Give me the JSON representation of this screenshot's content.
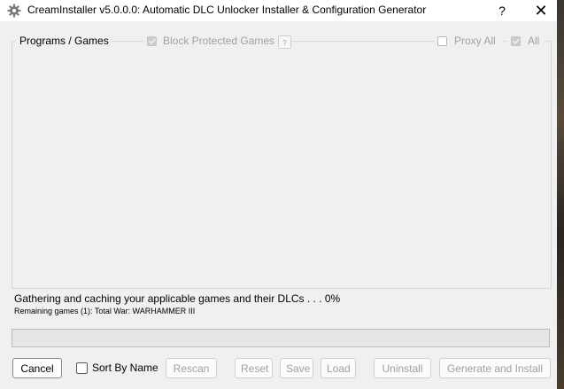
{
  "window": {
    "title": "CreamInstaller v5.0.0.0: Automatic DLC Unlocker Installer & Configuration Generator",
    "help_label": "?",
    "close_label": "✕"
  },
  "group": {
    "title": "Programs / Games",
    "block_protected_label": "Block Protected Games",
    "block_protected_checked": true,
    "help_label": "?",
    "proxy_all_label": "Proxy All",
    "proxy_all_checked": false,
    "all_label": "All",
    "all_checked": true
  },
  "status": {
    "main": "Gathering and caching your applicable games and their DLCs . . . 0%",
    "sub": "Remaining games (1): Total War: WARHAMMER III",
    "progress_percent": 0
  },
  "buttons": {
    "cancel": "Cancel",
    "sort_by_name": "Sort By Name",
    "sort_by_name_checked": false,
    "rescan": "Rescan",
    "reset": "Reset",
    "save": "Save",
    "load": "Load",
    "uninstall": "Uninstall",
    "generate_install": "Generate and Install"
  },
  "colors": {
    "window_bg": "#f0f0f0",
    "disabled_text": "#a0a0a0"
  }
}
